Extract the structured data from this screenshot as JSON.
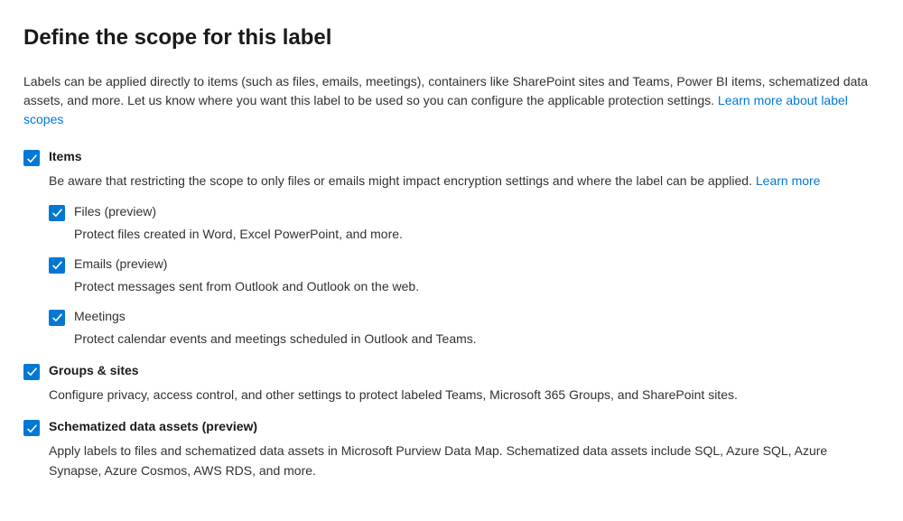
{
  "title": "Define the scope for this label",
  "intro": "Labels can be applied directly to items (such as files, emails, meetings), containers like SharePoint sites and Teams, Power BI items, schematized data assets, and more. Let us know where you want this label to be used so you can configure the applicable protection settings. ",
  "intro_link": "Learn more about label scopes",
  "items": {
    "label": "Items",
    "desc": "Be aware that restricting the scope to only files or emails might impact encryption settings and where the label can be applied. ",
    "desc_link": "Learn more",
    "sub": [
      {
        "label": "Files (preview)",
        "desc": "Protect files created in Word, Excel PowerPoint, and more."
      },
      {
        "label": "Emails (preview)",
        "desc": "Protect messages sent from Outlook and Outlook on the web."
      },
      {
        "label": "Meetings",
        "desc": "Protect calendar events and meetings scheduled in Outlook and Teams."
      }
    ]
  },
  "groups": {
    "label": "Groups & sites",
    "desc": "Configure privacy, access control, and other settings to protect labeled Teams, Microsoft 365 Groups, and SharePoint sites."
  },
  "schematized": {
    "label": "Schematized data assets (preview)",
    "desc": "Apply labels to files and schematized data assets in Microsoft Purview Data Map. Schematized data assets include SQL, Azure SQL, Azure Synapse, Azure Cosmos, AWS RDS, and more."
  }
}
